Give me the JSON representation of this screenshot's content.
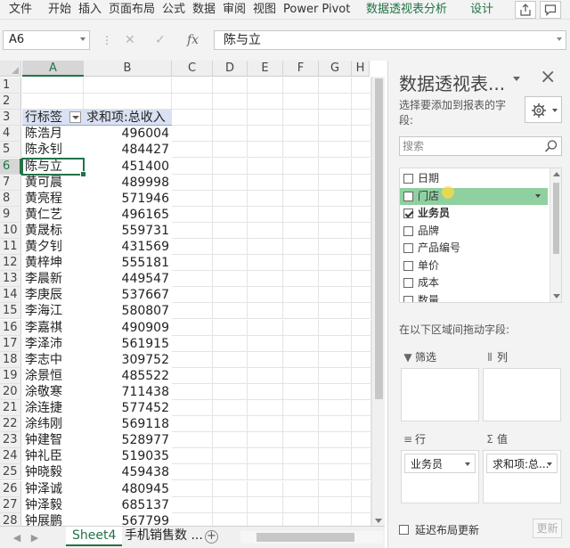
{
  "ribbon": {
    "tabs": [
      "文件",
      "开始",
      "插入",
      "页面布局",
      "公式",
      "数据",
      "审阅",
      "视图",
      "Power Pivot"
    ],
    "context_tabs": [
      "数据透视表分析",
      "设计"
    ],
    "accent_color": "#217346"
  },
  "formula_bar": {
    "name_box": "A6",
    "fx": "fx",
    "content": "陈与立"
  },
  "sheet": {
    "columns": [
      "A",
      "B",
      "C",
      "D",
      "E",
      "F",
      "G",
      "H"
    ],
    "selected_column": "A",
    "header_row": {
      "row": "3",
      "a": "行标签",
      "b": "求和项:总收入"
    },
    "blank_rows": [
      "1",
      "2"
    ],
    "rows": [
      {
        "row": "4",
        "name": "陈浩月",
        "value": "496004"
      },
      {
        "row": "5",
        "name": "陈永钊",
        "value": "484427"
      },
      {
        "row": "6",
        "name": "陈与立",
        "value": "451400"
      },
      {
        "row": "7",
        "name": "黄可晨",
        "value": "489998"
      },
      {
        "row": "8",
        "name": "黄亮程",
        "value": "571946"
      },
      {
        "row": "9",
        "name": "黄仁艺",
        "value": "496165"
      },
      {
        "row": "10",
        "name": "黄晟标",
        "value": "559731"
      },
      {
        "row": "11",
        "name": "黄夕钊",
        "value": "431569"
      },
      {
        "row": "12",
        "name": "黄梓坤",
        "value": "555181"
      },
      {
        "row": "13",
        "name": "李晨新",
        "value": "449547"
      },
      {
        "row": "14",
        "name": "李庚辰",
        "value": "537667"
      },
      {
        "row": "15",
        "name": "李海江",
        "value": "580807"
      },
      {
        "row": "16",
        "name": "李嘉祺",
        "value": "490909"
      },
      {
        "row": "17",
        "name": "李泽沛",
        "value": "561915"
      },
      {
        "row": "18",
        "name": "李志中",
        "value": "309752"
      },
      {
        "row": "19",
        "name": "涂景恒",
        "value": "485522"
      },
      {
        "row": "20",
        "name": "涂敬寒",
        "value": "711438"
      },
      {
        "row": "21",
        "name": "涂连捷",
        "value": "577452"
      },
      {
        "row": "22",
        "name": "涂纬刚",
        "value": "569118"
      },
      {
        "row": "23",
        "name": "钟建智",
        "value": "528977"
      },
      {
        "row": "24",
        "name": "钟礼臣",
        "value": "519035"
      },
      {
        "row": "25",
        "name": "钟晓毅",
        "value": "459438"
      },
      {
        "row": "26",
        "name": "钟泽诚",
        "value": "480945"
      },
      {
        "row": "27",
        "name": "钟泽毅",
        "value": "685137"
      },
      {
        "row": "28",
        "name": "钟展鹏",
        "value": "567799"
      }
    ],
    "active_row": "6"
  },
  "sheet_tabs": {
    "tabs": [
      "Sheet4",
      "手机销售数 ..."
    ],
    "add_label": "+"
  },
  "pivot": {
    "title": "数据透视表...",
    "description": "选择要添加到报表的字段:",
    "search_placeholder": "搜索",
    "fields": [
      {
        "label": "日期",
        "checked": false
      },
      {
        "label": "门店",
        "checked": false
      },
      {
        "label": "业务员",
        "checked": true
      },
      {
        "label": "品牌",
        "checked": false
      },
      {
        "label": "产品编号",
        "checked": false
      },
      {
        "label": "单价",
        "checked": false
      },
      {
        "label": "成本",
        "checked": false
      },
      {
        "label": "数量",
        "checked": false
      }
    ],
    "drag_hint": "在以下区域间拖动字段:",
    "areas": {
      "filters": "筛选",
      "columns": "列",
      "rows": "行",
      "values": "值"
    },
    "row_chip": "业务员",
    "value_chip": "求和项:总...",
    "defer_label": "延迟布局更新",
    "update_label": "更新"
  }
}
